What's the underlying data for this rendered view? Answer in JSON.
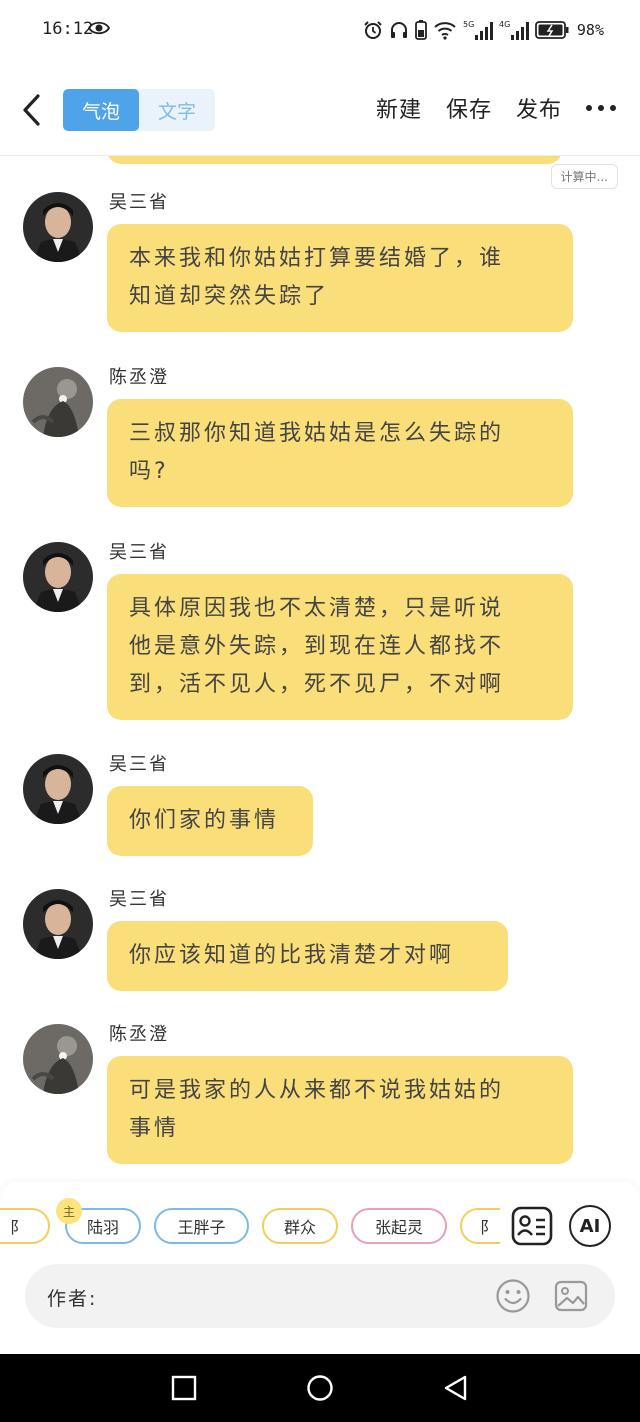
{
  "status_bar": {
    "time": "16:12",
    "battery": "98%",
    "signal_1": "5G",
    "signal_2": "4G"
  },
  "nav": {
    "tabs": [
      "气泡",
      "文字"
    ],
    "active_tab": "气泡",
    "actions": {
      "new": "新建",
      "save": "保存",
      "publish": "发布"
    }
  },
  "chat": {
    "calc_badge": "计算中...",
    "messages": [
      {
        "sender": "吴三省",
        "lines": [
          "本来我和你姑姑打算要结婚了，谁",
          "知道却突然失踪了"
        ]
      },
      {
        "sender": "陈丞澄",
        "lines": [
          "三叔那你知道我姑姑是怎么失踪的",
          "吗?"
        ]
      },
      {
        "sender": "吴三省",
        "lines": [
          "具体原因我也不太清楚，只是听说",
          "他是意外失踪，到现在连人都找不",
          "到，活不见人，死不见尸，不对啊"
        ]
      },
      {
        "sender": "吴三省",
        "lines": [
          "你们家的事情"
        ]
      },
      {
        "sender": "吴三省",
        "lines": [
          "你应该知道的比我清楚才对啊"
        ]
      },
      {
        "sender": "陈丞澄",
        "lines": [
          "可是我家的人从来都不说我姑姑的",
          "事情"
        ]
      }
    ]
  },
  "characters": {
    "owner_badge": "主",
    "chips": [
      {
        "label": "阝",
        "color": "#f2cf5a"
      },
      {
        "label": "陆羽",
        "color": "#7fb8e6"
      },
      {
        "label": "王胖子",
        "color": "#7fb8e6"
      },
      {
        "label": "群众",
        "color": "#f2cf5a"
      },
      {
        "label": "张起灵",
        "color": "#e7a0b4"
      },
      {
        "label": "阝",
        "color": "#f2cf5a"
      }
    ],
    "ai_label": "AI"
  },
  "input": {
    "author_label": "作者:"
  },
  "colors": {
    "bubble": "#fade7a",
    "accent": "#4fa3e8"
  }
}
